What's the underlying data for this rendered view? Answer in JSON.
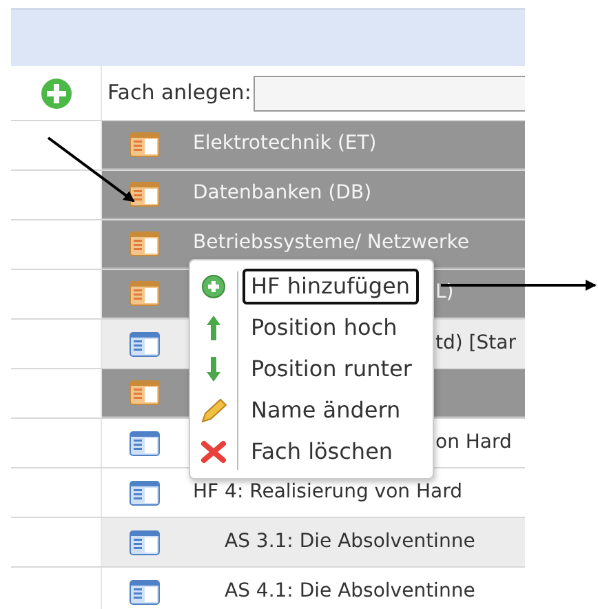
{
  "add_row": {
    "label": "Fach anlegen:"
  },
  "rows": [
    {
      "kind": "fach",
      "text": "Elektrotechnik (ET)",
      "highlighted": false,
      "covered": false
    },
    {
      "kind": "fach",
      "text": "Datenbanken (DB)",
      "highlighted": false,
      "covered": false
    },
    {
      "kind": "fach",
      "text": "Betriebssysteme/ Netzwerke",
      "highlighted": false,
      "covered": false
    },
    {
      "kind": "fach",
      "text": "L)",
      "highlighted": false,
      "covered": true
    },
    {
      "kind": "hf",
      "text": "td) [Star",
      "highlighted": true,
      "covered": true
    },
    {
      "kind": "fach",
      "highlighted": false
    },
    {
      "kind": "hf",
      "text": "on Hard",
      "highlighted": false,
      "covered": true
    },
    {
      "kind": "hf",
      "text": "HF 4: Realisierung von Hard",
      "highlighted": false,
      "covered": false,
      "children": [
        {
          "kind": "hf",
          "text": "AS 3.1: Die Absolventinne",
          "highlighted": true,
          "covered": false
        },
        {
          "kind": "hf",
          "text": "AS 4.1: Die Absolventinne",
          "highlighted": false,
          "covered": false
        }
      ]
    }
  ],
  "context_menu": [
    {
      "kind": "add",
      "label": "HF hinzufügen",
      "focused": true
    },
    {
      "kind": "up",
      "label": "Position hoch",
      "focused": false
    },
    {
      "kind": "down",
      "label": "Position runter",
      "focused": false
    },
    {
      "kind": "rename",
      "label": "Name ändern",
      "focused": false
    },
    {
      "kind": "delete",
      "label": "Fach löschen",
      "focused": false
    }
  ]
}
